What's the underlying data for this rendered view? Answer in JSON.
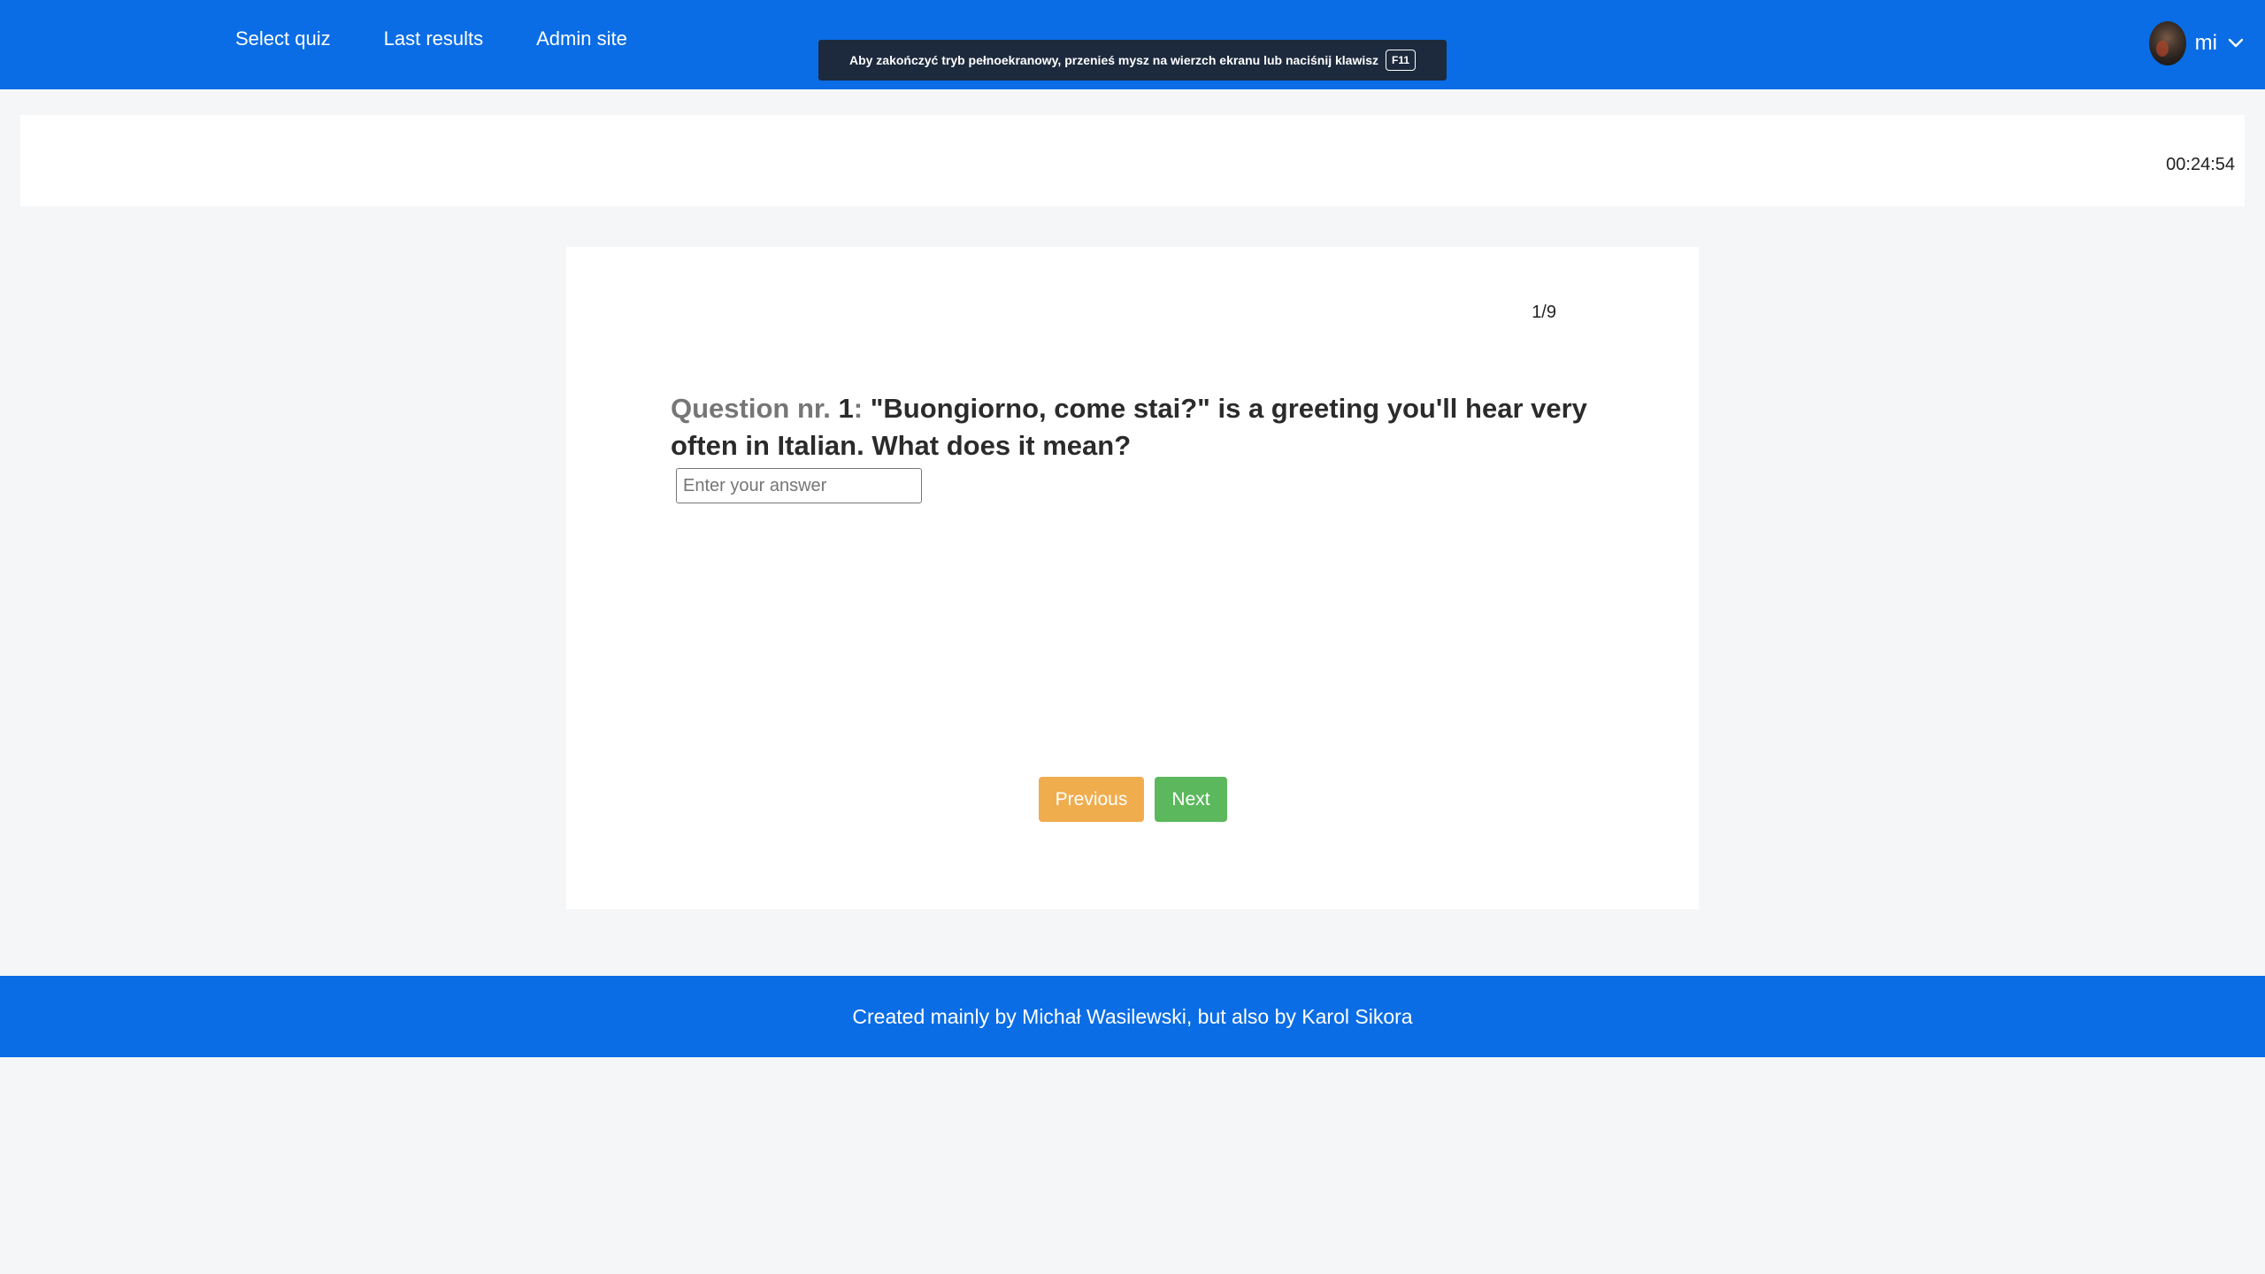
{
  "nav": {
    "links": [
      "Select quiz",
      "Last results",
      "Admin site"
    ],
    "user_name": "mi"
  },
  "fullscreen_notice": {
    "text": "Aby zakończyć tryb pełnoekranowy, przenieś mysz na wierzch ekranu lub naciśnij klawisz",
    "key": "F11"
  },
  "timer": "00:24:54",
  "quiz": {
    "progress": "1/9",
    "question_prefix": "Question nr.",
    "question_number": "1",
    "question_sep": ":",
    "question_text": "\"Buongiorno, come stai?\" is a greeting you'll hear very often in Italian. What does it mean?",
    "answer_placeholder": "Enter your answer",
    "answer_value": "",
    "previous_label": "Previous",
    "next_label": "Next"
  },
  "footer": {
    "text": "Created mainly by Michał Wasilewski, but also by Karol Sikora"
  },
  "colors": {
    "brand_blue": "#0a6de6",
    "previous_button": "#f0ad4e",
    "next_button": "#5cb85c",
    "toast_background": "#1d2a3d"
  }
}
